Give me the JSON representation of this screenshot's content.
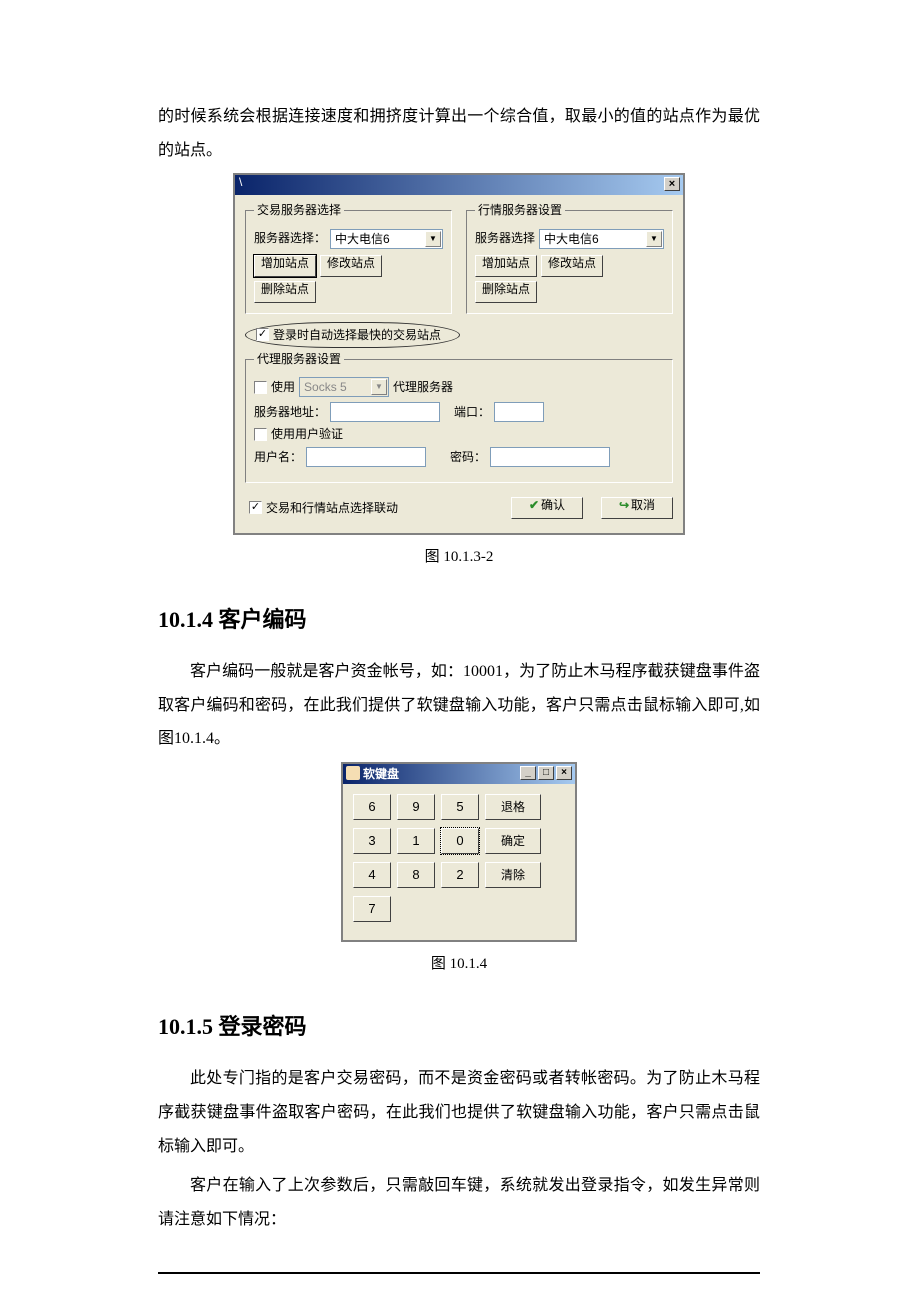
{
  "intro_paragraph": "的时候系统会根据连接速度和拥挤度计算出一个综合值，取最小的值的站点作为最优的站点。",
  "dialog1": {
    "close": "×",
    "trade_group": "交易服务器选择",
    "quote_group": "行情服务器设置",
    "server_label": "服务器选择：",
    "server_label2": "服务器选择",
    "server_value_trade": "中大电信6",
    "server_value_quote": "中大电信6",
    "add_site": "增加站点",
    "mod_site": "修改站点",
    "del_site": "删除站点",
    "auto_fastest": "登录时自动选择最快的交易站点",
    "proxy_group": "代理服务器设置",
    "use_proxy_prefix": "使用",
    "proxy_type": "Socks 5",
    "proxy_suffix": "代理服务器",
    "proxy_addr": "服务器地址：",
    "proxy_port": "端口：",
    "use_auth": "使用用户验证",
    "user_label": "用户名：",
    "pwd_label": "密码：",
    "sync_check": "交易和行情站点选择联动",
    "ok": "确认",
    "cancel": "取消"
  },
  "caption1": "图 10.1.3-2",
  "heading_1014": "10.1.4 客户编码",
  "para_1014": "客户编码一般就是客户资金帐号，如：10001，为了防止木马程序截获键盘事件盗取客户编码和密码，在此我们提供了软键盘输入功能，客户只需点击鼠标输入即可,如图10.1.4。",
  "softkb": {
    "title": "软键盘",
    "min": "_",
    "max": "□",
    "close": "×",
    "keys_row1": [
      "6",
      "9",
      "5"
    ],
    "keys_row2": [
      "3",
      "1",
      "0"
    ],
    "keys_row3": [
      "4",
      "8",
      "2"
    ],
    "keys_row4": [
      "7"
    ],
    "action_backspace": "退格",
    "action_ok": "确定",
    "action_clear": "清除"
  },
  "caption2": "图 10.1.4",
  "heading_1015": "10.1.5 登录密码",
  "para_1015a": "此处专门指的是客户交易密码，而不是资金密码或者转帐密码。为了防止木马程序截获键盘事件盗取客户密码，在此我们也提供了软键盘输入功能，客户只需点击鼠标输入即可。",
  "para_1015b": "客户在输入了上次参数后，只需敲回车键，系统就发出登录指令，如发生异常则请注意如下情况："
}
